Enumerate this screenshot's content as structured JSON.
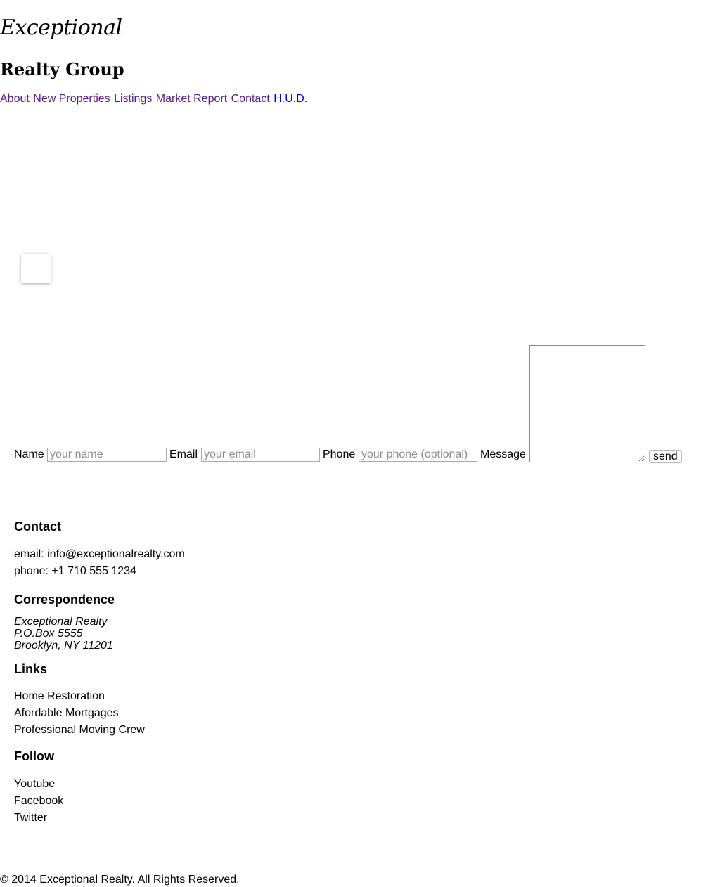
{
  "header": {
    "logo_line1": "Exceptional",
    "logo_line2": "Realty Group"
  },
  "nav": {
    "items": [
      {
        "label": "About"
      },
      {
        "label": "New Properties"
      },
      {
        "label": "Listings"
      },
      {
        "label": "Market Report"
      },
      {
        "label": "Contact"
      },
      {
        "label": "H.U.D."
      }
    ],
    "visited_color": "#551a8b",
    "link_color": "#0000ee"
  },
  "contact_form": {
    "name_label": "Name",
    "name_placeholder": "your name",
    "email_label": "Email",
    "email_placeholder": "your email",
    "phone_label": "Phone",
    "phone_placeholder": "your phone (optional)",
    "message_label": "Message",
    "send_label": "send"
  },
  "footer": {
    "contact": {
      "heading": "Contact",
      "email": "email: info@exceptionalrealty.com",
      "phone": "phone: +1 710 555 1234"
    },
    "correspondence": {
      "heading": "Correspondence",
      "lines": [
        "Exceptional Realty",
        "P.O.Box 5555",
        "Brooklyn, NY 11201"
      ]
    },
    "links": {
      "heading": "Links",
      "items": [
        "Home Restoration",
        "Afordable Mortgages",
        "Professional Moving Crew"
      ]
    },
    "follow": {
      "heading": "Follow",
      "items": [
        "Youtube",
        "Facebook",
        "Twitter"
      ]
    }
  },
  "copyright": "© 2014 Exceptional Realty. All Rights Reserved."
}
